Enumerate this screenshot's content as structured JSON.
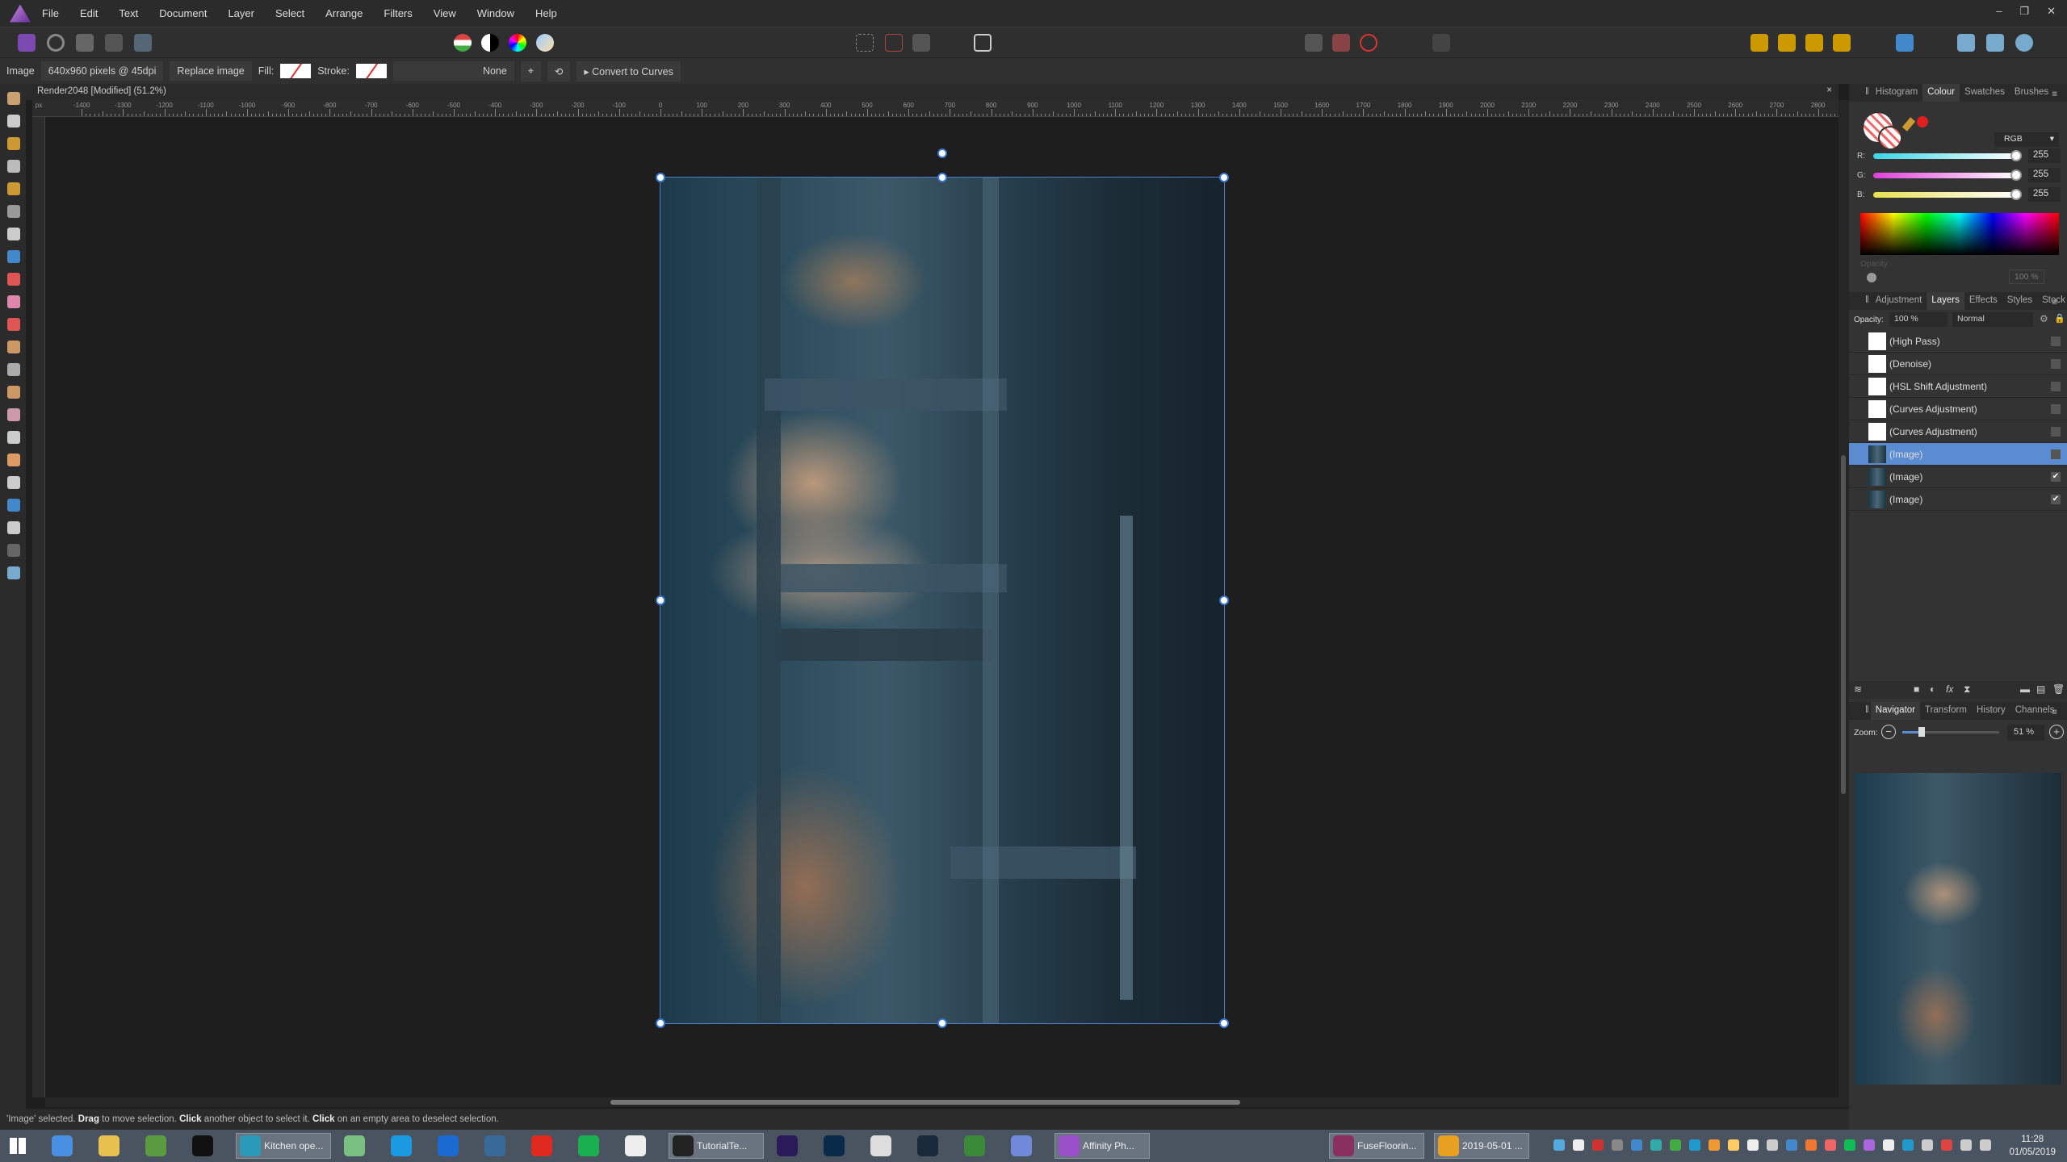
{
  "menu": {
    "items": [
      "File",
      "Edit",
      "Text",
      "Document",
      "Layer",
      "Select",
      "Arrange",
      "Filters",
      "View",
      "Window",
      "Help"
    ]
  },
  "context": {
    "type": "Image",
    "info": "640x960 pixels @ 45dpi",
    "replace": "Replace image",
    "fill": "Fill:",
    "stroke": "Stroke:",
    "stroke_width": "None",
    "convert": "Convert to Curves"
  },
  "doc": {
    "title": "Render2048 [Modified] (51.2%)",
    "close": "×"
  },
  "ruler": {
    "unit": "px",
    "start": -1400,
    "end": 2800,
    "step": 100
  },
  "status": {
    "parts": [
      [
        "'Image' selected. ",
        false
      ],
      [
        "Drag",
        true
      ],
      [
        " to move selection. ",
        false
      ],
      [
        "Click",
        true
      ],
      [
        " another object to select it. ",
        false
      ],
      [
        "Click",
        true
      ],
      [
        " on an empty area to deselect selection.",
        false
      ]
    ]
  },
  "colour_panel": {
    "tabs": [
      "Histogram",
      "Colour",
      "Swatches",
      "Brushes"
    ],
    "active": "Colour",
    "model": "RGB",
    "channels": [
      {
        "label": "R:",
        "value": "255",
        "color": "#3cd6e6"
      },
      {
        "label": "G:",
        "value": "255",
        "color": "#e040d8"
      },
      {
        "label": "B:",
        "value": "255",
        "color": "#e8e050"
      }
    ],
    "opacity_label": "Opacity",
    "opacity": "100 %",
    "current_color": "#e02020"
  },
  "layers_panel": {
    "tabs": [
      "Adjustment",
      "Layers",
      "Effects",
      "Styles",
      "Stock"
    ],
    "active": "Layers",
    "opacity_label": "Opacity:",
    "opacity": "100 %",
    "blend": "Normal",
    "layers": [
      {
        "name": "(High Pass)",
        "type": "filter",
        "checked": false,
        "selected": false
      },
      {
        "name": "(Denoise)",
        "type": "filter",
        "checked": false,
        "selected": false
      },
      {
        "name": "(HSL Shift Adjustment)",
        "type": "adjust",
        "checked": false,
        "selected": false
      },
      {
        "name": "(Curves Adjustment)",
        "type": "adjust",
        "checked": false,
        "selected": false
      },
      {
        "name": "(Curves Adjustment)",
        "type": "adjust",
        "checked": false,
        "selected": false
      },
      {
        "name": "(Image)",
        "type": "image",
        "checked": false,
        "selected": true
      },
      {
        "name": "(Image)",
        "type": "image",
        "checked": true,
        "selected": false
      },
      {
        "name": "(Image)",
        "type": "image",
        "checked": true,
        "selected": false
      }
    ]
  },
  "navigator": {
    "tabs": [
      "Navigator",
      "Transform",
      "History",
      "Channels"
    ],
    "active": "Navigator",
    "zoom_label": "Zoom:",
    "zoom": "51 %"
  },
  "taskbar": {
    "windows": [
      {
        "label": "Kitchen ope...",
        "color": "#2a9ab8"
      },
      {
        "label": "TutorialTe...",
        "color": "#222"
      },
      {
        "label": "Affinity Ph...",
        "color": "#9a50c8"
      },
      {
        "label": "FuseFloorin...",
        "color": "#8a3060"
      },
      {
        "label": "2019-05-01 ...",
        "color": "#e8a020"
      }
    ],
    "icons": [
      {
        "name": "chrome",
        "color": "#4a90e2"
      },
      {
        "name": "explorer",
        "color": "#e8c050"
      },
      {
        "name": "app-green",
        "color": "#5a9a40"
      },
      {
        "name": "mixamo",
        "color": "#111"
      },
      {
        "name": "app-slime",
        "color": "#7ac080"
      },
      {
        "name": "skype",
        "color": "#1a9ae0"
      },
      {
        "name": "teamviewer",
        "color": "#1a6ad0"
      },
      {
        "name": "app-cube",
        "color": "#3a6a9a"
      },
      {
        "name": "power",
        "color": "#e02a20"
      },
      {
        "name": "spotify",
        "color": "#1ab050"
      },
      {
        "name": "slack",
        "color": "#eee"
      },
      {
        "name": "after-effects",
        "color": "#2a1a5a"
      },
      {
        "name": "photoshop",
        "color": "#0a2a4a"
      },
      {
        "name": "mail",
        "color": "#ddd"
      },
      {
        "name": "lightroom",
        "color": "#1a2a3a"
      },
      {
        "name": "app-xbox",
        "color": "#3a8a3a"
      },
      {
        "name": "discord",
        "color": "#7289da"
      }
    ],
    "date": "01/05/2019",
    "time": "11:28"
  }
}
